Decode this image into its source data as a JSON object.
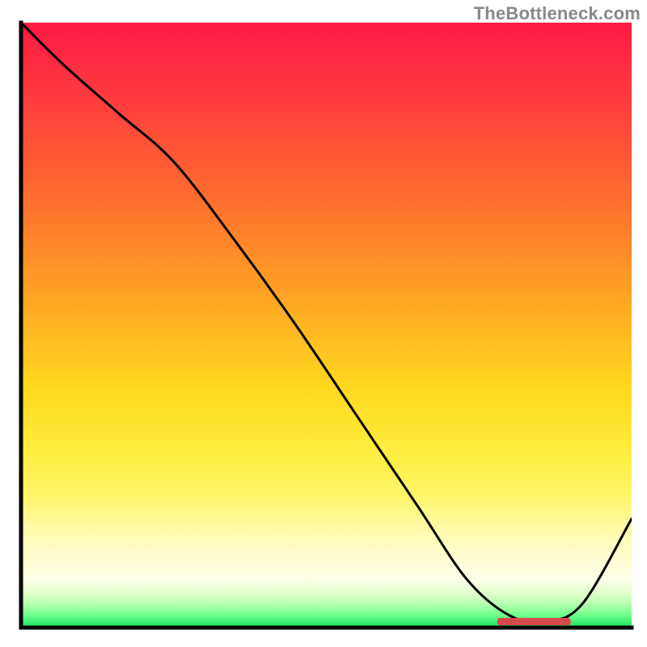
{
  "watermark": "TheBottleneck.com",
  "colors": {
    "axis": "#000000",
    "curve": "#000000",
    "marker": "#d64a4a"
  },
  "chart_data": {
    "type": "line",
    "title": "",
    "xlabel": "",
    "ylabel": "",
    "xlim": [
      0,
      1
    ],
    "ylim": [
      0,
      1
    ],
    "grid": false,
    "series": [
      {
        "name": "bottleneck-curve",
        "x": [
          0.0,
          0.07,
          0.16,
          0.25,
          0.35,
          0.45,
          0.55,
          0.65,
          0.73,
          0.8,
          0.86,
          0.92,
          1.0
        ],
        "y": [
          1.0,
          0.93,
          0.85,
          0.77,
          0.64,
          0.5,
          0.35,
          0.2,
          0.08,
          0.02,
          0.01,
          0.04,
          0.18
        ],
        "color": "#000000",
        "linewidth": 3
      }
    ],
    "annotations": [
      {
        "name": "optimum-marker",
        "shape": "rounded-bar",
        "x": 0.84,
        "y": 0.01,
        "width": 0.12,
        "height": 0.012,
        "color": "#d64a4a"
      }
    ],
    "background_gradient": {
      "direction": "vertical",
      "stops": [
        {
          "pos": 0.0,
          "color": "#ff1a44"
        },
        {
          "pos": 0.45,
          "color": "#ffa324"
        },
        {
          "pos": 0.7,
          "color": "#ffec3a"
        },
        {
          "pos": 0.92,
          "color": "#ffffe8"
        },
        {
          "pos": 1.0,
          "color": "#18e060"
        }
      ]
    }
  }
}
